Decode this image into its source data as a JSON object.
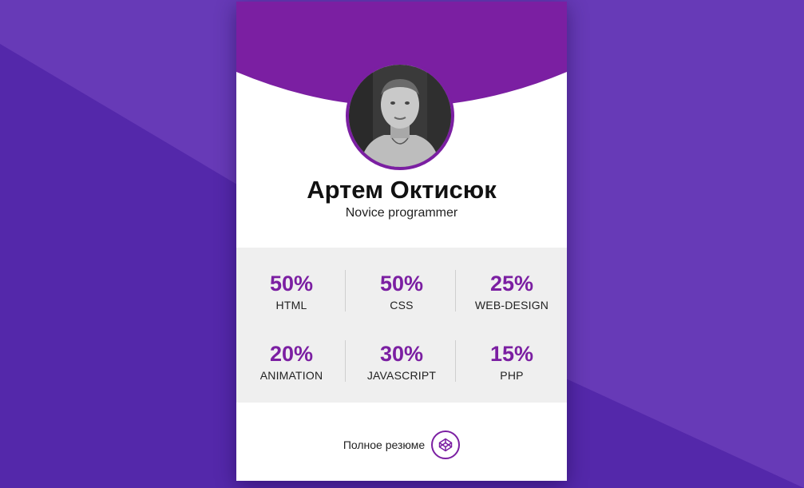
{
  "colors": {
    "accent": "#7b1fa2",
    "background": "#5a2fb0",
    "background_light": "#6a3bbd",
    "stats_panel": "#efefef"
  },
  "profile": {
    "name": "Артем Октисюк",
    "role": "Novice programmer"
  },
  "stats": [
    {
      "value": "50%",
      "label": "HTML"
    },
    {
      "value": "50%",
      "label": "CSS"
    },
    {
      "value": "25%",
      "label": "WEB-DESIGN"
    },
    {
      "value": "20%",
      "label": "ANIMATION"
    },
    {
      "value": "30%",
      "label": "JAVASCRIPT"
    },
    {
      "value": "15%",
      "label": "PHP"
    }
  ],
  "resume": {
    "label": "Полное резюме",
    "icon": "codepen-icon"
  }
}
